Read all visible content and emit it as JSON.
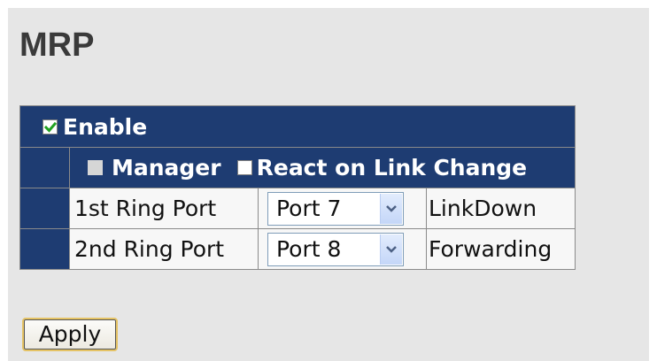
{
  "page": {
    "title": "MRP"
  },
  "mrp": {
    "enable": {
      "label": "Enable",
      "checked": true
    },
    "manager": {
      "label": "Manager",
      "checked": false
    },
    "react_on_link_change": {
      "label": "React on Link Change",
      "checked": false
    },
    "ring_ports": [
      {
        "label": "1st Ring Port",
        "selected_port": "Port 7",
        "status": "LinkDown"
      },
      {
        "label": "2nd Ring Port",
        "selected_port": "Port 8",
        "status": "Forwarding"
      }
    ]
  },
  "actions": {
    "apply_label": "Apply"
  },
  "colors": {
    "header_bg": "#1e3c72",
    "panel_bg": "#e6e6e6",
    "apply_border": "#e5c365"
  },
  "icons": {
    "checkmark": "checkmark-icon",
    "dropdown": "chevron-down-icon"
  }
}
